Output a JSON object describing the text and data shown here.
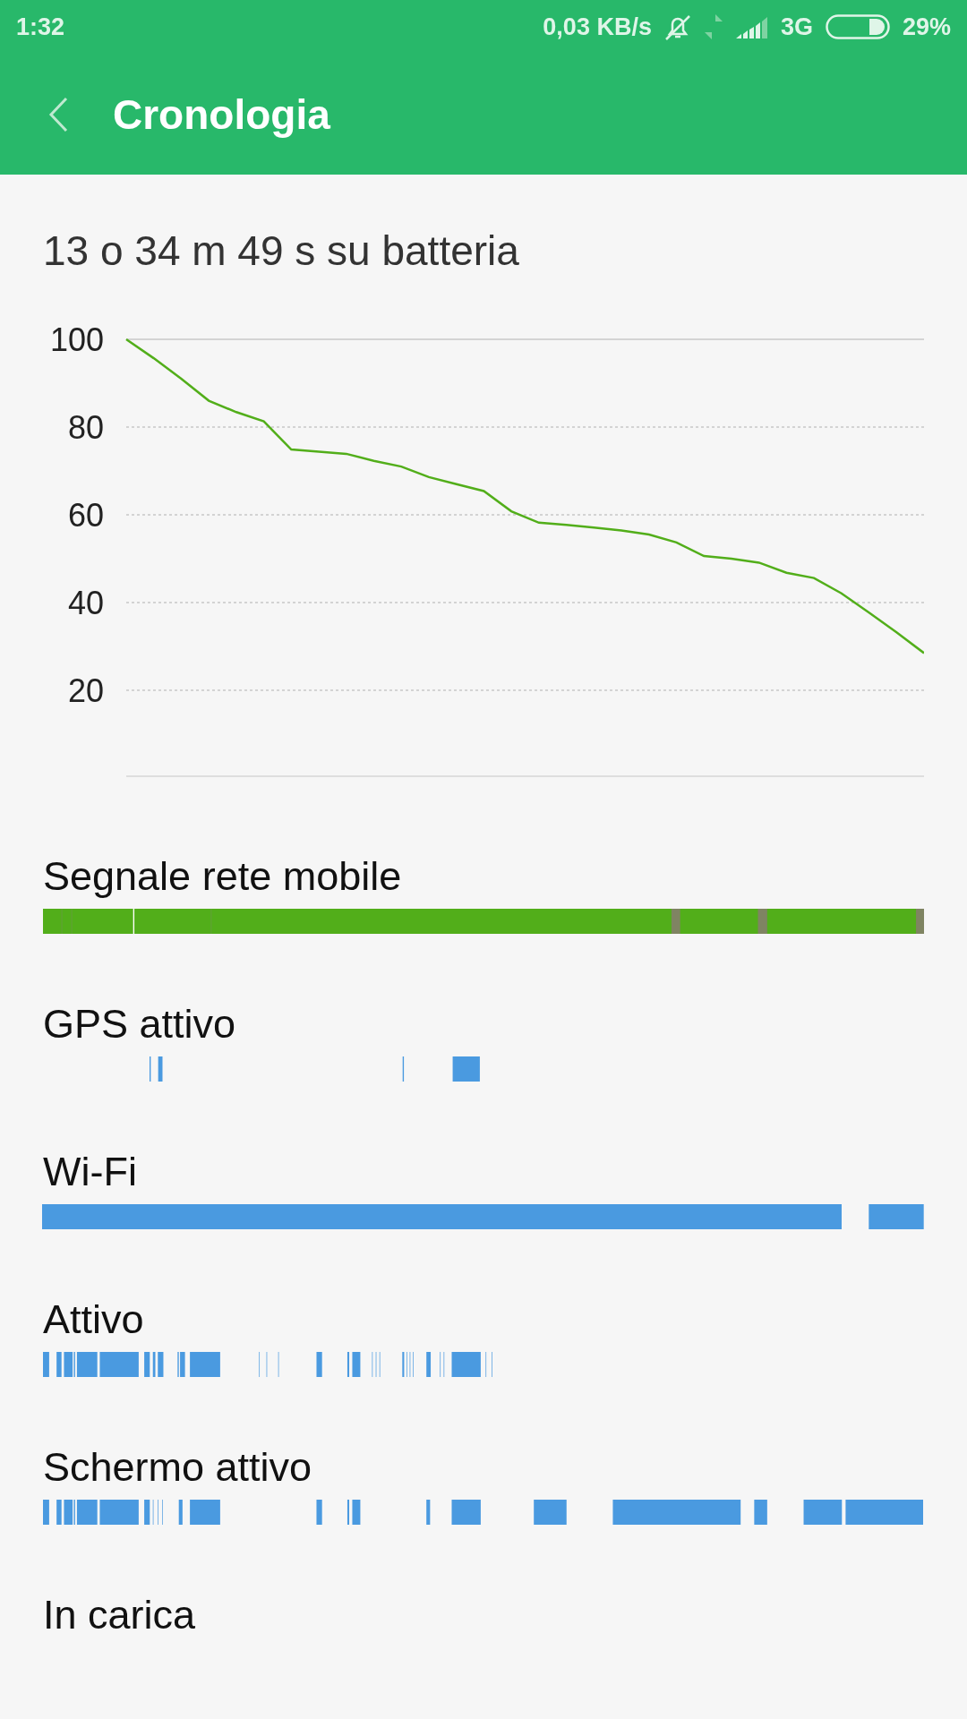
{
  "status_bar": {
    "time": "1:32",
    "speed": "0,03 KB/s",
    "network": "3G",
    "battery": "29%"
  },
  "header": {
    "title": "Cronologia"
  },
  "summary": "13 o 34 m 49 s su batteria",
  "battery_chart": {
    "chart_data": {
      "type": "line",
      "ylim": [
        0,
        100
      ],
      "grid": true,
      "yticks": [
        20,
        40,
        60,
        80,
        100
      ],
      "categories": [
        null,
        null,
        null,
        null,
        null,
        null,
        null,
        null,
        null,
        null,
        null,
        null,
        null,
        null,
        null,
        null,
        null,
        null,
        null,
        null,
        null,
        null,
        null,
        null,
        null,
        null,
        null,
        null,
        null,
        null
      ],
      "series": [
        {
          "color": "#52ae1a",
          "values": [
            100,
            95.7,
            91,
            86,
            83.4,
            81.3,
            74.9,
            74.4,
            73.9,
            72.3,
            71,
            68.6,
            67,
            65.4,
            60.8,
            58.2,
            57.7,
            57.1,
            56.4,
            55.5,
            53.7,
            50.6,
            50,
            49.1,
            46.8,
            45.6,
            42.1,
            37.7,
            33.2,
            28.5
          ]
        }
      ]
    }
  },
  "sections": [
    {
      "title": "Segnale rete mobile"
    },
    {
      "title": "GPS attivo"
    },
    {
      "title": "Wi-Fi"
    },
    {
      "title": "Attivo"
    },
    {
      "title": "Schermo attivo"
    },
    {
      "title": "In carica"
    }
  ]
}
